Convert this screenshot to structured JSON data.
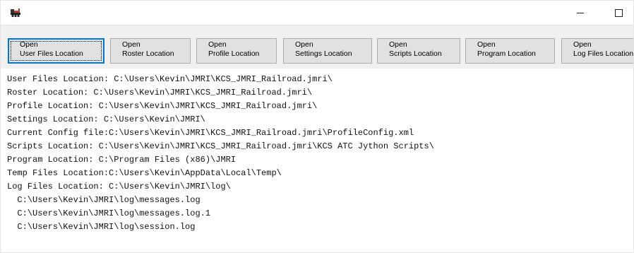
{
  "window": {
    "app_icon": "jmri-locomotive-icon",
    "minimize_glyph": "–",
    "maximize_glyph": "□"
  },
  "toolbar": {
    "buttons": [
      {
        "line1": "Open",
        "line2": "User Files Location",
        "focused": true
      },
      {
        "line1": "Open",
        "line2": "Roster Location"
      },
      {
        "line1": "Open",
        "line2": "Profile Location"
      },
      {
        "line1": "Open",
        "line2": "Settings Location"
      },
      {
        "line1": "Open",
        "line2": "Scripts Location"
      },
      {
        "line1": "Open",
        "line2": "Program Location"
      },
      {
        "line1": "Open",
        "line2": "Log Files Location"
      }
    ]
  },
  "content": {
    "lines": [
      "User Files Location: C:\\Users\\Kevin\\JMRI\\KCS_JMRI_Railroad.jmri\\",
      "Roster Location: C:\\Users\\Kevin\\JMRI\\KCS_JMRI_Railroad.jmri\\",
      "Profile Location: C:\\Users\\Kevin\\JMRI\\KCS_JMRI_Railroad.jmri\\",
      "Settings Location: C:\\Users\\Kevin\\JMRI\\",
      "Current Config file:C:\\Users\\Kevin\\JMRI\\KCS_JMRI_Railroad.jmri\\ProfileConfig.xml",
      "Scripts Location: C:\\Users\\Kevin\\JMRI\\KCS_JMRI_Railroad.jmri\\KCS ATC Jython Scripts\\",
      "Program Location: C:\\Program Files (x86)\\JMRI",
      "Temp Files Location:C:\\Users\\Kevin\\AppData\\Local\\Temp\\",
      "Log Files Location: C:\\Users\\Kevin\\JMRI\\log\\",
      "  C:\\Users\\Kevin\\JMRI\\log\\messages.log",
      "  C:\\Users\\Kevin\\JMRI\\log\\messages.log.1",
      "  C:\\Users\\Kevin\\JMRI\\log\\session.log"
    ]
  },
  "colors": {
    "toolbar_bg": "#f0f0f0",
    "button_bg": "#e1e1e1",
    "button_border": "#adadad",
    "focus_accent": "#0078d7"
  }
}
